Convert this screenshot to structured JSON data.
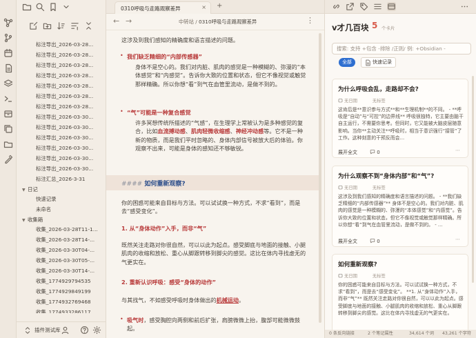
{
  "colors": {
    "accent_red": "#b83a3a",
    "heading_blue": "#2b4d8a",
    "chip_blue": "#2f6fd0",
    "count_red": "#d85a4a"
  },
  "explorer": {
    "files_top": [
      "标注导出_2026-03-28...",
      "标注导出_2026-03-28...",
      "标注导出_2026-03-28...",
      "标注导出_2026-03-28...",
      "标注导出_2026-03-28...",
      "标注导出_2026-03-28...",
      "标注导出_2026-03-28...",
      "标注导出_2026-03-30...",
      "标注导出_2026-03-30...",
      "标注导出_2026-03-30...",
      "标注导出_2026-03-30...",
      "标注导出_2026-03-30...",
      "标注导出_2026-03-30...",
      "标注汇总_2026-3-31"
    ],
    "folder_diary": "日记",
    "diary_items": [
      "快速记录",
      "未命名"
    ],
    "folder_inbox": "收集箱",
    "inbox_items": [
      "收集_2026-03-28T11-1...",
      "收集_2026-03-28T14-...",
      "收集_2026-03-30T04-...",
      "收集_2026-03-30T05-...",
      "收集_2026-03-30T14-...",
      "收集_1774929794535",
      "收集_1774929849199",
      "收集_1774932769468",
      "收集_1774933286117"
    ],
    "vault_name": "插件测试库"
  },
  "tab": {
    "title": "0310呼吸与走路观察差异",
    "close": "×",
    "add": "+"
  },
  "editor": {
    "breadcrumb_folder": "中转站",
    "breadcrumb_sep": "/",
    "breadcrumb_file": "0310呼吸与走路观察差异",
    "p0": "这涉及到我们感知的精确度和语言描述的问题。",
    "h1": "我们缺乏精细的“内部传感器”",
    "p1": "身体不是空心的。我们对内脏、肌肉的感觉是一种模糊的、弥漫的“本体感觉”和“内感觉”。告诉你大致的位置和状态，但它不像视觉或触觉那样精确。所以你想“看”到气在血管里流动，是做不到的。",
    "h2": "“气”可能是一种复合感觉",
    "p2a": "许多冥想传统所描述的“气感”，在生理学上常被认为是多种感觉的复合，比如",
    "p2r1": "血流搏动感",
    "p2r2": "肌肉轻微收缩感",
    "p2r3": "神经冲动感",
    "p2b": "等。它不是一种新的物质，而是我们平时忽略的、身体内部信号被放大后的体验。你观察不出来，可能是身体的感知还不够敏锐。",
    "h4_hash": "####",
    "h4": "如何重新观察?",
    "p3": "你的困惑可能来自目标与方法。可以试试换一种方式，不求“看到”，而是去“感受变化”。",
    "s1": "1. 从“身体动作”入手，而非“气”",
    "p4": "既然关注走路对你很自然，可以以此为起点。感受脚底与地面的接触、小腿肌肉的收缩和放松、重心从脚跟转移到脚尖的感觉。这比在体内寻找虚无的气更实在。",
    "s2": "2. 重新认识呼吸：感受“身体的动作”",
    "p5a": "与其找气，不如感受呼吸时身体做出的",
    "p5u": "机械运动",
    "p5b": "。",
    "b1r": "吸气时",
    "b1": "，感受胸腔向两侧和前后扩张，肩膀微微上抬，腹部可能微微鼓起。"
  },
  "rpanel": {
    "title": "v才几百块",
    "count": "5",
    "count_unit": "个卡片",
    "search_placeholder": "搜索: 支持 +包含 -排除 /正则/ 例: +Obsidian -",
    "chip_all": "全部",
    "chip_quick": "快速记录",
    "cards": [
      {
        "title": "为什么呼吸会乱，走路却不会?",
        "date": "无日期",
        "tag": "无标签",
        "body": "这肯后是**意识参与方式**和**生理机制**的不同。 - **呼吸是“自动”与“可控”的边界线** 呼吸很独特，它主要由脑干自主运行，不需要你思考。但同时，它又能被大脑皮层随意影响。当你**主动关注**呼吸时，相当于意识强行“接管”了工作。这种刻意的干预反而会...",
        "expand": "展开全文",
        "comments": "0"
      },
      {
        "title": "为什么观察不到“身体内部”和“气”?",
        "date": "无日期",
        "tag": "无标签",
        "body": "这涉及到我们感知的精确度和语言描述的问题。 - **我们缺乏精细的“内部传感器”** 身体不是空心的。我们对内脏、肌肉的感觉是一种模糊的、弥漫的“本体感觉”和“内感觉”。告诉你大致的位置和状态，但它不像视觉或触觉那样精确。所以你想“看”到气在血管里流动，是做不到的。 - ...",
        "expand": "展开全文",
        "comments": "0"
      },
      {
        "title": "如何重新观察?",
        "date": "无日期",
        "tag": "无标签",
        "body": "你的困惑可能来自目标与方法。可以试试换一种方式，不求“看到”，而是去“感受变化”。 **1. 从“身体动作”入手，而非“气”** 既然关注走路对你很自然，可以以此为起点。感受脚底与地面的接触、小腿肌肉的收缩和放松、重心从脚跟转移到脚尖的感觉。这比在体内寻找虚无的气更实在。",
        "expand": "展开全文",
        "comments": "0"
      }
    ]
  },
  "status": {
    "backlinks": "0 条反向链接",
    "elements": "2 个笔记属性",
    "words": "34,614 个词",
    "chars": "43,261 个字符"
  }
}
